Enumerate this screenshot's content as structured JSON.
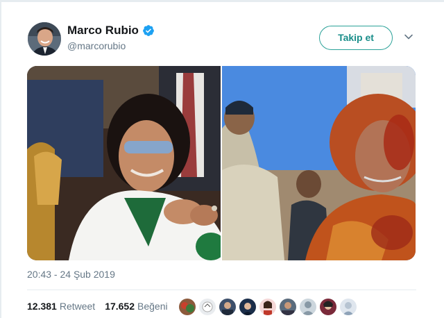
{
  "tweet": {
    "author": {
      "display_name": "Marco Rubio",
      "handle": "@marcorubio",
      "verified": true
    },
    "follow_label": "Takip et",
    "timestamp": "20:43 - 24 Şub 2019",
    "stats": {
      "retweet_count": "12.381",
      "retweet_label": "Retweet",
      "like_count": "17.652",
      "like_label": "Beğeni"
    },
    "liker_count_shown": 9
  },
  "colors": {
    "accent": "#1da1f2",
    "follow_border": "#2aa198",
    "text_primary": "#14171a",
    "text_secondary": "#657786",
    "divider": "#e6ecf0"
  },
  "icons": {
    "verified": "verified-badge-icon",
    "caret": "chevron-down-icon"
  }
}
